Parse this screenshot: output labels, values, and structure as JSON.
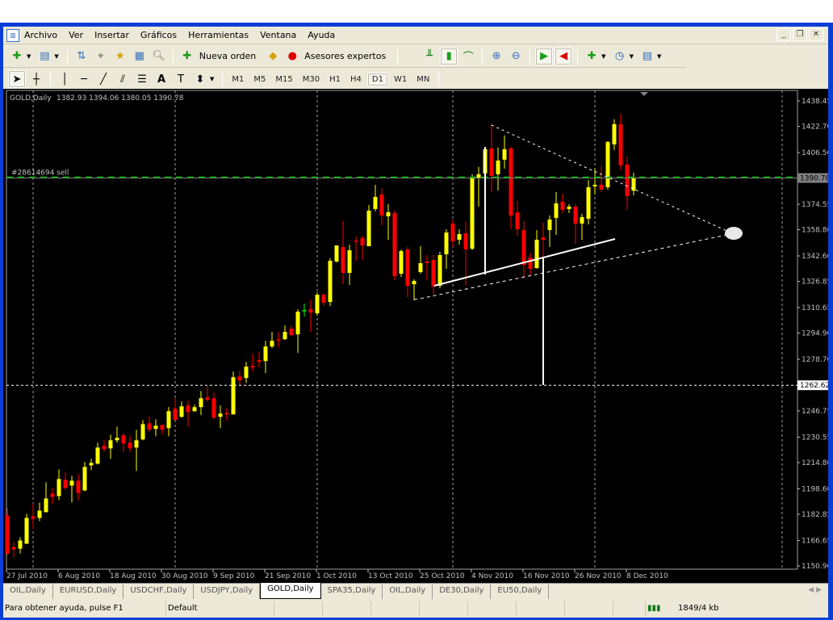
{
  "menu": [
    "Archivo",
    "Ver",
    "Insertar",
    "Gráficos",
    "Herramientas",
    "Ventana",
    "Ayuda"
  ],
  "toolbar": {
    "new_order": "Nueva orden",
    "experts": "Asesores expertos"
  },
  "timeframes": [
    "M1",
    "M5",
    "M15",
    "M30",
    "H1",
    "H4",
    "D1",
    "W1",
    "MN"
  ],
  "active_timeframe": "D1",
  "tabs": [
    "OIL,Daily",
    "EURUSD,Daily",
    "USDCHF,Daily",
    "USDJPY,Daily",
    "GOLD,Daily",
    "SPA35,Daily",
    "OIL,Daily",
    "DE30,Daily",
    "EU50,Daily"
  ],
  "active_tab": "GOLD,Daily",
  "status": {
    "help": "Para obtener ayuda, pulse F1",
    "profile": "Default",
    "traffic": "1849/4 kb"
  },
  "colors": {
    "bull": "#ffff00",
    "bear": "#ff0000",
    "doji": "#00ff00",
    "order_line": "#00c000",
    "background": "#000000"
  },
  "chart_data": {
    "type": "candlestick",
    "title": "GOLD,Daily",
    "header_values": "1382.93 1394.06 1380.05 1390.78",
    "order_label": "#28614694 sell",
    "current_price": "1390.78",
    "hline_price": "1262.62",
    "ylim": [
      1150.9,
      1438.45
    ],
    "y_ticks": [
      "1438.45",
      "1422.70",
      "1406.50",
      "1374.55",
      "1358.80",
      "1342.60",
      "1326.85",
      "1310.65",
      "1294.90",
      "1278.70",
      "1246.75",
      "1230.55",
      "1214.80",
      "1198.60",
      "1182.85",
      "1166.65",
      "1150.90"
    ],
    "x_labels": [
      {
        "i": 0,
        "t": "27 Jul 2010"
      },
      {
        "i": 8,
        "t": "6 Aug 2010"
      },
      {
        "i": 16,
        "t": "18 Aug 2010"
      },
      {
        "i": 24,
        "t": "30 Aug 2010"
      },
      {
        "i": 32,
        "t": "9 Sep 2010"
      },
      {
        "i": 40,
        "t": "21 Sep 2010"
      },
      {
        "i": 48,
        "t": "1 Oct 2010"
      },
      {
        "i": 56,
        "t": "13 Oct 2010"
      },
      {
        "i": 64,
        "t": "25 Oct 2010"
      },
      {
        "i": 72,
        "t": "4 Nov 2010"
      },
      {
        "i": 80,
        "t": "16 Nov 2010"
      },
      {
        "i": 88,
        "t": "26 Nov 2010"
      },
      {
        "i": 96,
        "t": "8 Dec 2010"
      }
    ],
    "ohlc": [
      [
        1182.1,
        1186.6,
        1157.6,
        1158.6
      ],
      [
        1162.6,
        1165.6,
        1156.1,
        1161.1
      ],
      [
        1161.6,
        1168.6,
        1158.6,
        1166.6
      ],
      [
        1164.6,
        1183.1,
        1164.6,
        1180.6
      ],
      [
        1181.6,
        1189.6,
        1173.6,
        1180.1
      ],
      [
        1180.6,
        1190.1,
        1178.6,
        1185.1
      ],
      [
        1184.1,
        1202.6,
        1184.1,
        1192.6
      ],
      [
        1195.6,
        1199.1,
        1189.1,
        1193.6
      ],
      [
        1194.1,
        1210.6,
        1191.6,
        1204.6
      ],
      [
        1204.1,
        1209.1,
        1198.1,
        1199.1
      ],
      [
        1200.6,
        1206.6,
        1190.1,
        1203.6
      ],
      [
        1203.6,
        1207.6,
        1191.6,
        1196.1
      ],
      [
        1197.6,
        1215.1,
        1197.1,
        1212.1
      ],
      [
        1213.1,
        1217.1,
        1210.1,
        1214.6
      ],
      [
        1214.1,
        1227.1,
        1213.6,
        1224.1
      ],
      [
        1225.1,
        1228.6,
        1221.6,
        1223.1
      ],
      [
        1223.6,
        1232.1,
        1217.1,
        1228.6
      ],
      [
        1228.6,
        1237.1,
        1227.1,
        1230.1
      ],
      [
        1231.6,
        1233.1,
        1221.1,
        1226.6
      ],
      [
        1227.1,
        1231.6,
        1221.1,
        1223.6
      ],
      [
        1224.1,
        1235.1,
        1209.6,
        1228.6
      ],
      [
        1229.1,
        1241.1,
        1228.6,
        1238.6
      ],
      [
        1239.1,
        1243.6,
        1233.6,
        1235.1
      ],
      [
        1235.6,
        1241.6,
        1231.1,
        1237.6
      ],
      [
        1238.1,
        1238.1,
        1232.6,
        1235.1
      ],
      [
        1236.1,
        1249.1,
        1231.1,
        1246.6
      ],
      [
        1248.1,
        1254.6,
        1241.1,
        1241.1
      ],
      [
        1243.1,
        1252.6,
        1242.6,
        1249.6
      ],
      [
        1250.1,
        1253.1,
        1237.1,
        1246.1
      ],
      [
        1246.6,
        1250.6,
        1246.1,
        1249.1
      ],
      [
        1249.1,
        1259.1,
        1244.1,
        1254.6
      ],
      [
        1255.1,
        1262.1,
        1252.6,
        1253.6
      ],
      [
        1254.6,
        1258.1,
        1241.6,
        1242.6
      ],
      [
        1243.1,
        1250.1,
        1236.1,
        1245.1
      ],
      [
        1245.6,
        1248.6,
        1240.6,
        1244.6
      ],
      [
        1244.6,
        1271.1,
        1244.6,
        1267.6
      ],
      [
        1268.1,
        1271.6,
        1262.6,
        1265.6
      ],
      [
        1267.1,
        1277.1,
        1264.1,
        1274.1
      ],
      [
        1274.6,
        1282.1,
        1271.1,
        1273.6
      ],
      [
        1278.1,
        1283.1,
        1273.6,
        1277.1
      ],
      [
        1277.6,
        1290.1,
        1270.1,
        1286.6
      ],
      [
        1286.6,
        1295.6,
        1285.6,
        1290.1
      ],
      [
        1291.1,
        1295.6,
        1286.1,
        1290.6
      ],
      [
        1291.1,
        1299.6,
        1290.6,
        1295.6
      ],
      [
        1297.6,
        1299.6,
        1293.1,
        1293.6
      ],
      [
        1294.1,
        1309.6,
        1282.6,
        1308.1
      ],
      [
        1309.1,
        1313.1,
        1305.1,
        1309.1
      ],
      [
        1309.6,
        1315.6,
        1295.6,
        1307.6
      ],
      [
        1307.1,
        1320.1,
        1305.6,
        1318.6
      ],
      [
        1318.6,
        1319.6,
        1311.6,
        1313.6
      ],
      [
        1314.1,
        1341.1,
        1311.6,
        1339.6
      ],
      [
        1339.1,
        1349.1,
        1338.6,
        1349.1
      ],
      [
        1348.1,
        1364.1,
        1325.1,
        1332.1
      ],
      [
        1332.1,
        1349.6,
        1324.6,
        1346.1
      ],
      [
        1352.1,
        1354.6,
        1339.6,
        1351.6
      ],
      [
        1353.6,
        1355.1,
        1340.1,
        1349.1
      ],
      [
        1348.6,
        1374.1,
        1348.6,
        1370.6
      ],
      [
        1371.6,
        1386.6,
        1370.1,
        1379.1
      ],
      [
        1380.6,
        1384.6,
        1361.6,
        1367.6
      ],
      [
        1367.1,
        1374.6,
        1352.6,
        1369.6
      ],
      [
        1369.1,
        1370.6,
        1327.6,
        1330.1
      ],
      [
        1331.6,
        1346.6,
        1329.6,
        1345.6
      ],
      [
        1346.6,
        1348.1,
        1317.1,
        1324.1
      ],
      [
        1325.1,
        1328.1,
        1315.1,
        1327.1
      ],
      [
        1332.6,
        1348.6,
        1331.6,
        1338.1
      ],
      [
        1339.1,
        1343.1,
        1327.6,
        1338.1
      ],
      [
        1340.1,
        1343.1,
        1318.6,
        1323.6
      ],
      [
        1324.1,
        1345.1,
        1322.6,
        1343.1
      ],
      [
        1343.6,
        1359.1,
        1334.6,
        1357.1
      ],
      [
        1362.6,
        1365.1,
        1348.1,
        1351.6
      ],
      [
        1352.6,
        1359.1,
        1349.6,
        1356.1
      ],
      [
        1356.6,
        1363.6,
        1324.6,
        1346.6
      ],
      [
        1347.1,
        1393.1,
        1346.1,
        1391.1
      ],
      [
        1390.6,
        1397.6,
        1373.1,
        1393.1
      ],
      [
        1393.6,
        1409.6,
        1392.1,
        1408.6
      ],
      [
        1409.1,
        1424.1,
        1382.1,
        1392.1
      ],
      [
        1393.1,
        1409.6,
        1383.1,
        1401.6
      ],
      [
        1402.1,
        1417.1,
        1396.6,
        1408.6
      ],
      [
        1409.1,
        1410.1,
        1359.1,
        1367.6
      ],
      [
        1369.6,
        1376.6,
        1355.1,
        1359.1
      ],
      [
        1358.6,
        1364.1,
        1329.1,
        1337.1
      ],
      [
        1341.6,
        1344.6,
        1330.1,
        1334.6
      ],
      [
        1335.1,
        1358.6,
        1334.6,
        1352.6
      ],
      [
        1354.1,
        1363.1,
        1341.1,
        1352.6
      ],
      [
        1358.6,
        1367.6,
        1348.1,
        1365.1
      ],
      [
        1366.1,
        1382.1,
        1355.6,
        1375.1
      ],
      [
        1376.1,
        1381.1,
        1369.1,
        1371.1
      ],
      [
        1371.6,
        1374.6,
        1369.1,
        1373.1
      ],
      [
        1373.1,
        1374.6,
        1350.1,
        1362.6
      ],
      [
        1362.6,
        1368.6,
        1352.6,
        1366.6
      ],
      [
        1365.6,
        1389.6,
        1362.1,
        1385.1
      ],
      [
        1385.6,
        1396.6,
        1380.6,
        1386.6
      ],
      [
        1386.6,
        1398.1,
        1382.1,
        1383.6
      ],
      [
        1385.1,
        1413.6,
        1383.6,
        1413.1
      ],
      [
        1411.6,
        1427.1,
        1408.1,
        1424.1
      ],
      [
        1424.1,
        1430.6,
        1395.6,
        1398.6
      ],
      [
        1399.1,
        1404.1,
        1371.1,
        1379.6
      ],
      [
        1382.93,
        1394.06,
        1380.05,
        1390.78
      ]
    ]
  }
}
